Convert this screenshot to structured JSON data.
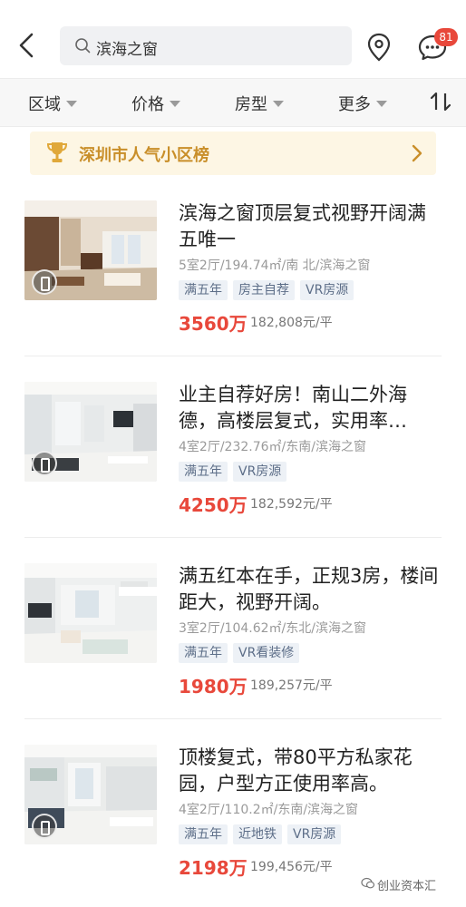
{
  "header": {
    "search_text": "滨海之窗",
    "badge_count": "81"
  },
  "filters": [
    "区域",
    "价格",
    "房型",
    "更多"
  ],
  "banner": {
    "text": "深圳市人气小区榜"
  },
  "listings": [
    {
      "title": "滨海之窗顶层复式视野开阔满五唯一",
      "meta": "5室2厅/194.74㎡/南 北/滨海之窗",
      "tags": [
        "满五年",
        "房主自荐",
        "VR房源"
      ],
      "price": "3560万",
      "unit_price": "182,808元/平"
    },
    {
      "title": "业主自荐好房！南山二外海德，高楼层复式，实用率…",
      "meta": "4室2厅/232.76㎡/东南/滨海之窗",
      "tags": [
        "满五年",
        "VR房源"
      ],
      "price": "4250万",
      "unit_price": "182,592元/平"
    },
    {
      "title": "满五红本在手，正规3房，楼间距大，视野开阔。",
      "meta": "3室2厅/104.62㎡/东北/滨海之窗",
      "tags": [
        "满五年",
        "VR看装修"
      ],
      "price": "1980万",
      "unit_price": "189,257元/平"
    },
    {
      "title": "顶楼复式，带80平方私家花园，户型方正使用率高。",
      "meta": "4室2厅/110.2㎡/东南/滨海之窗",
      "tags": [
        "满五年",
        "近地铁",
        "VR房源"
      ],
      "price": "2198万",
      "unit_price": "199,456元/平"
    }
  ],
  "watermark": "创业资本汇",
  "colors": {
    "accent": "#e8483b",
    "banner_bg": "#fdf6e4",
    "banner_text": "#c98f2a",
    "tag_bg": "#edf1f6",
    "tag_text": "#5d6e88"
  }
}
